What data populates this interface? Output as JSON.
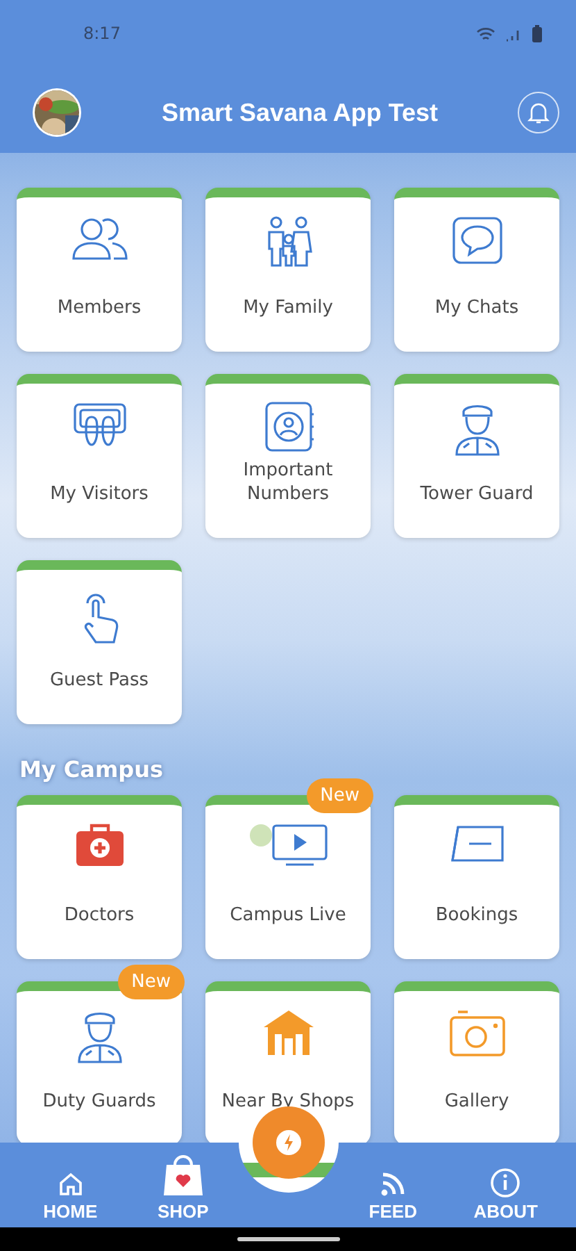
{
  "status_bar": {
    "time": "8:17"
  },
  "app_bar": {
    "title": "Smart Savana App Test"
  },
  "sections": [
    {
      "tiles": [
        {
          "label": "Members"
        },
        {
          "label": "My Family"
        },
        {
          "label": "My Chats"
        },
        {
          "label": "My Visitors"
        },
        {
          "label": "Important Numbers"
        },
        {
          "label": "Tower  Guard"
        },
        {
          "label": "Guest Pass"
        }
      ]
    },
    {
      "title": "My Campus",
      "tiles": [
        {
          "label": "Doctors"
        },
        {
          "label": "Campus Live",
          "badge": "New"
        },
        {
          "label": "Bookings"
        },
        {
          "label": "Duty Guards",
          "badge": "New"
        },
        {
          "label": "Near By Shops"
        },
        {
          "label": "Gallery"
        }
      ]
    }
  ],
  "bottom_nav": [
    {
      "label": "HOME"
    },
    {
      "label": "SHOP"
    },
    {
      "label": "FEED"
    },
    {
      "label": "ABOUT"
    }
  ]
}
